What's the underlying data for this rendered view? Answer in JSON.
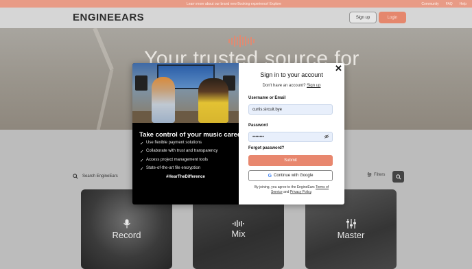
{
  "banner": {
    "message": "Learn more about our brand new Booking experience! Explore",
    "links": [
      "Community",
      "FAQ",
      "Help"
    ]
  },
  "nav": {
    "logo": "ENGINEEARS",
    "signup": "Sign up",
    "login": "Login"
  },
  "hero": {
    "title": "Your trusted source for"
  },
  "search": {
    "placeholder": "Search EngineEars",
    "filters": "Filters"
  },
  "cards": [
    {
      "label": "Record"
    },
    {
      "label": "Mix"
    },
    {
      "label": "Master"
    }
  ],
  "modal": {
    "left": {
      "headline": "Take control of your music career.",
      "features": [
        "Use flexible payment solutions",
        "Collaborate with trust and transparency",
        "Access project management tools",
        "State-of-the-art file encryption"
      ],
      "hashtag": "#HearTheDifference"
    },
    "right": {
      "title": "Sign in to your account",
      "no_account": "Don't have an account?",
      "signup_link": "Sign up",
      "username_label": "Username or Email",
      "username_value": "curtis.sircuit.bye",
      "password_label": "Password",
      "password_value": "••••••••",
      "forgot": "Forgot password?",
      "submit": "Submit",
      "google": "Continue with Google",
      "terms_prefix": "By joining, you agree to the EngineEars",
      "terms_link": "Terms of Service",
      "terms_and": "and",
      "privacy_link": "Privacy Policy",
      "terms_suffix": "."
    }
  },
  "colors": {
    "accent": "#e8876e",
    "banner": "#e89b86",
    "input_bg": "#e8effb"
  },
  "icons": {
    "close": "close-icon",
    "eye": "eye-slash-icon",
    "google": "google-icon",
    "search": "search-icon",
    "filters": "filter-icon",
    "check": "check-icon"
  }
}
